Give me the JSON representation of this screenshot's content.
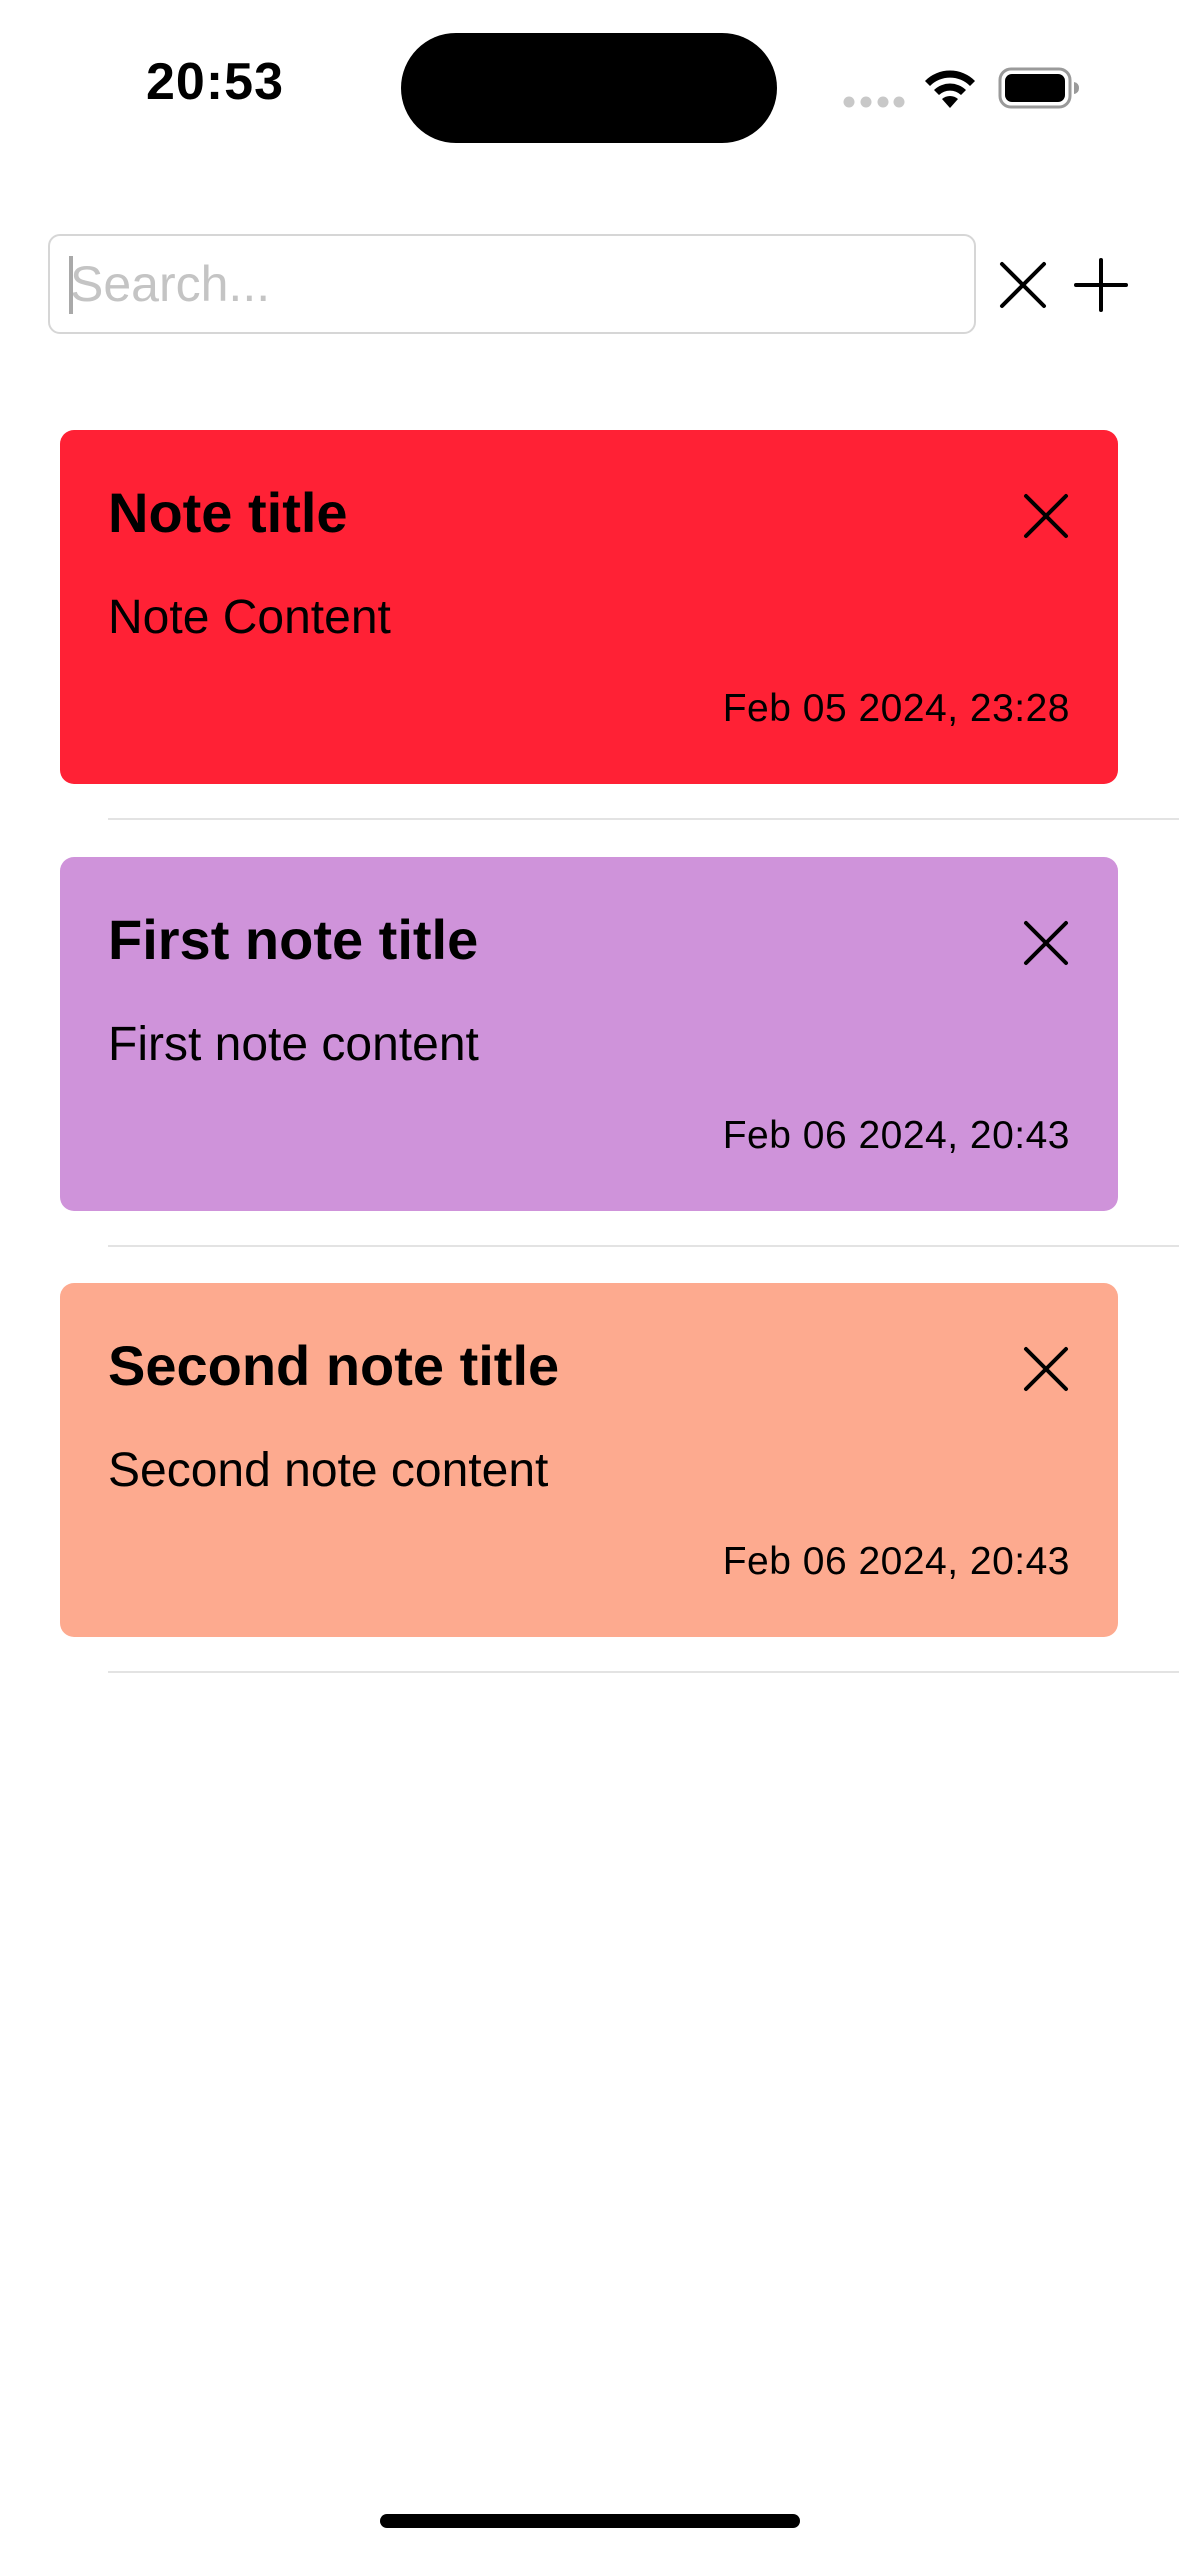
{
  "status_bar": {
    "time": "20:53",
    "icons": [
      "cellular-signal-icon",
      "wifi-icon",
      "battery-icon"
    ]
  },
  "search": {
    "value": "",
    "placeholder": "Search...",
    "clear_icon": "close-icon",
    "add_icon": "plus-icon"
  },
  "notes": [
    {
      "title": "Note title",
      "content": "Note Content",
      "date": "Feb 05 2024, 23:28",
      "color": "#ff2135",
      "delete_icon": "close-icon"
    },
    {
      "title": "First note title",
      "content": "First note content",
      "date": "Feb 06 2024, 20:43",
      "color": "#cf93da",
      "delete_icon": "close-icon"
    },
    {
      "title": "Second note title",
      "content": "Second note content",
      "date": "Feb 06 2024, 20:43",
      "color": "#fdaa8f",
      "delete_icon": "close-icon"
    }
  ]
}
